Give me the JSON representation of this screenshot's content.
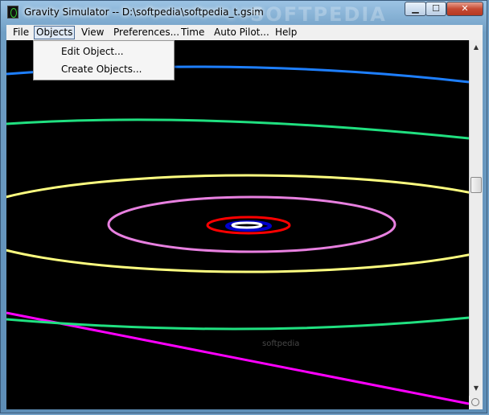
{
  "window": {
    "title": "Gravity Simulator -- D:\\softpedia\\softpedia_t.gsim",
    "min_label": "▁",
    "max_label": "☐",
    "close_label": "✕",
    "watermark": "SOFTPEDIA"
  },
  "menu": {
    "items": [
      "File",
      "Objects",
      "View",
      "Preferences...",
      "Time",
      "Auto Pilot...",
      "Help"
    ],
    "active_index": 1
  },
  "objects_menu": {
    "items": [
      "Edit Object...",
      "Create Objects..."
    ]
  },
  "canvas": {
    "background": "#000000",
    "watermark_top": "softpedia",
    "watermark_bottom": "softpedia",
    "orbits": [
      {
        "name": "blue-orbit",
        "color": "#1e7fff"
      },
      {
        "name": "green-orbit",
        "color": "#20e080"
      },
      {
        "name": "yellow-orbit",
        "color": "#ffff80"
      },
      {
        "name": "violet-orbit",
        "color": "#e880e0"
      },
      {
        "name": "red-orbit",
        "color": "#ff0000"
      },
      {
        "name": "navy-orbit",
        "color": "#0000cc"
      },
      {
        "name": "white-orbit",
        "color": "#ffffff"
      },
      {
        "name": "magenta-trajectory",
        "color": "#ff00ff"
      }
    ]
  },
  "scrollbar": {
    "up_icon": "▲",
    "down_icon": "▼"
  }
}
